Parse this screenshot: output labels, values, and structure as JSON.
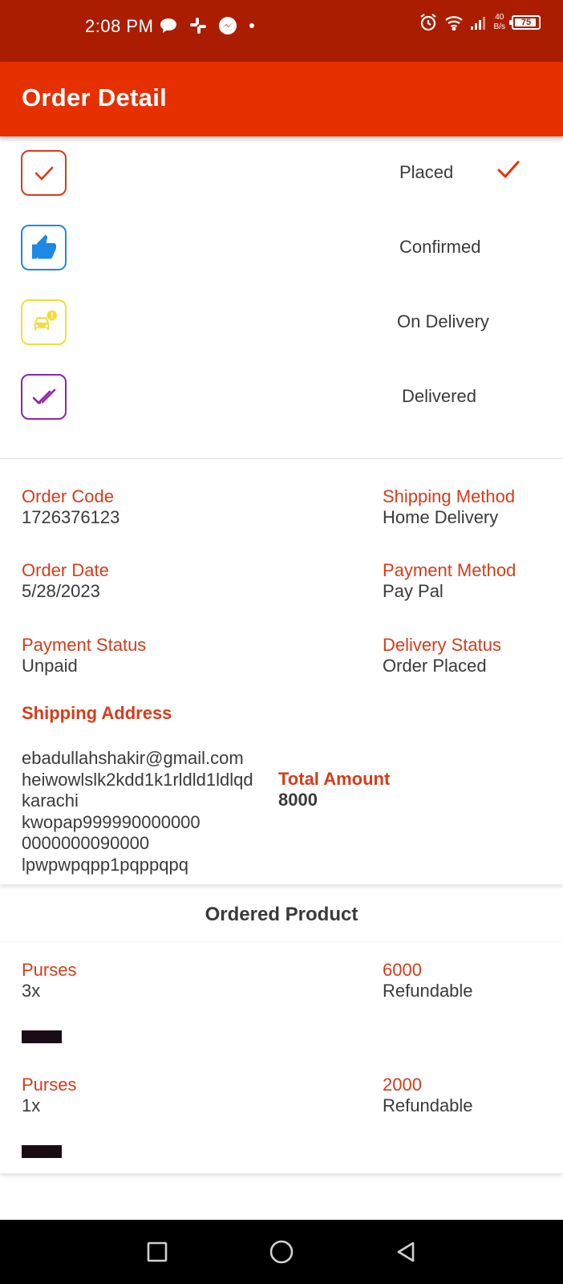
{
  "status_bar": {
    "time": "2:08 PM",
    "net_speed_value": "40",
    "net_speed_unit": "B/s",
    "battery": "75",
    "icons": [
      "chat-bubble-icon",
      "slack-icon",
      "messenger-icon",
      "dot-icon",
      "alarm-icon",
      "wifi-icon",
      "signal-icon",
      "battery-icon"
    ]
  },
  "app_bar": {
    "title": "Order Detail"
  },
  "timeline": {
    "steps": [
      {
        "label": "Placed",
        "icon": "check-icon",
        "color": "#d63c1a",
        "done": true
      },
      {
        "label": "Confirmed",
        "icon": "thumbs-up-icon",
        "color": "#1e88e5",
        "done": false
      },
      {
        "label": "On Delivery",
        "icon": "delivery-car-icon",
        "color": "#f5dc3a",
        "done": false
      },
      {
        "label": "Delivered",
        "icon": "double-check-icon",
        "color": "#8e24aa",
        "done": false
      }
    ]
  },
  "details": {
    "order_code_label": "Order Code",
    "order_code": "1726376123",
    "shipping_method_label": "Shipping Method",
    "shipping_method": "Home Delivery",
    "order_date_label": "Order Date",
    "order_date": "5/28/2023",
    "payment_method_label": "Payment Method",
    "payment_method": "Pay Pal",
    "payment_status_label": "Payment Status",
    "payment_status": "Unpaid",
    "delivery_status_label": "Delivery Status",
    "delivery_status": "Order Placed",
    "shipping_address_label": "Shipping Address",
    "address_lines": [
      "ebadullahshakir@gmail.com",
      "heiwowlslk2kdd1k1rldld1ldlqd",
      "karachi",
      "kwopap999990000000",
      "0000000090000",
      "lpwpwpqpp1pqppqpq"
    ],
    "total_amount_label": "Total Amount",
    "total_amount": "8000"
  },
  "products": {
    "title": "Ordered Product",
    "items": [
      {
        "name": "Purses",
        "qty": "3x",
        "price": "6000",
        "refund": "Refundable"
      },
      {
        "name": "Purses",
        "qty": "1x",
        "price": "2000",
        "refund": "Refundable"
      }
    ]
  },
  "nav": {
    "icons": [
      "recent-apps-icon",
      "home-icon",
      "back-icon"
    ]
  }
}
